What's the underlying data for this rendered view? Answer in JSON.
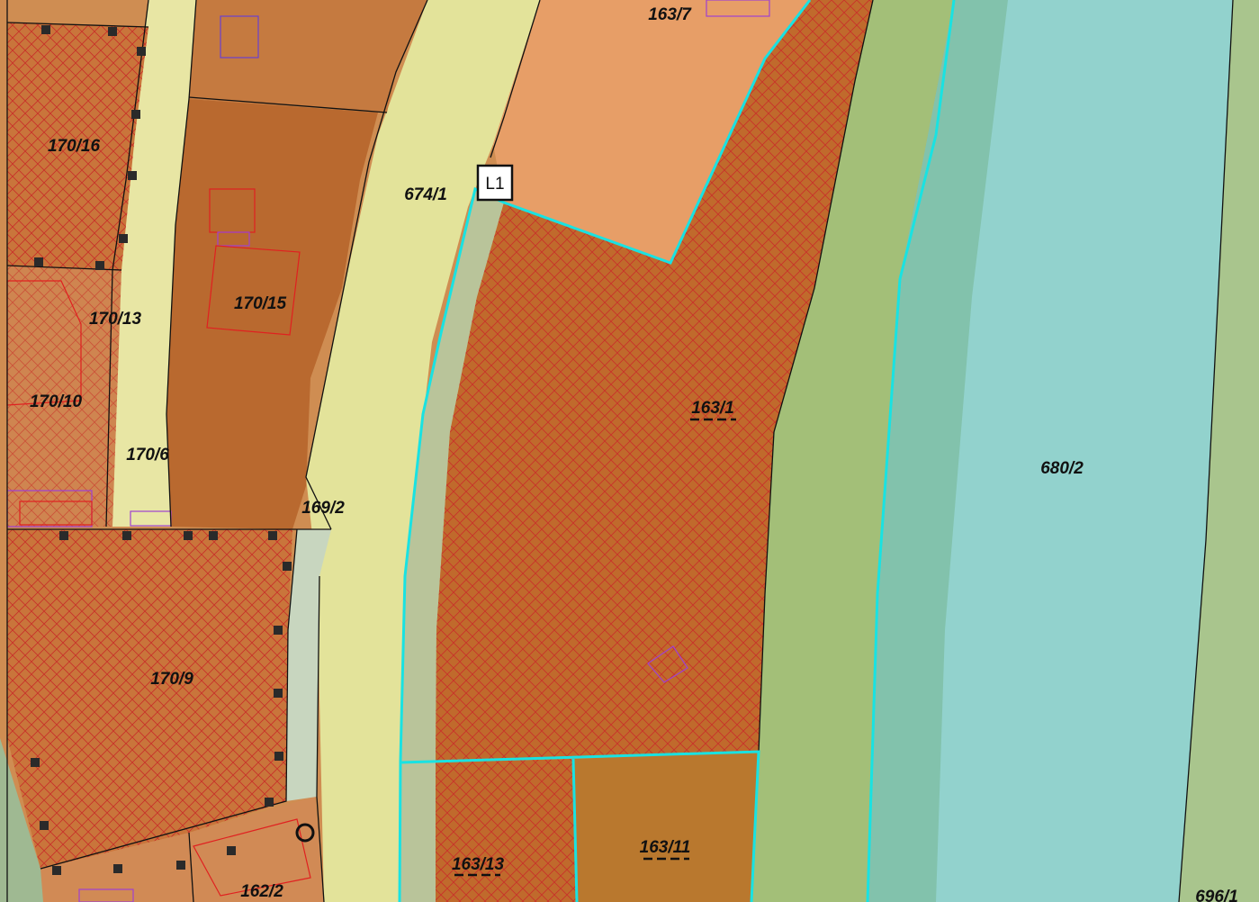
{
  "map": {
    "colors": {
      "parcel_fill": "#c9753b",
      "hatch": "#c8322a",
      "road": "#e6e49a",
      "sidewalk": "#f0efb0",
      "river": "#8fd3cf",
      "riverbank": "#9cbf7a",
      "highlight": "#19e2e2",
      "boundary": "#111111",
      "building_outline": "#e02020",
      "building_outline_alt": "#a040d0"
    },
    "parcels": {
      "p170_16": "170/16",
      "p170_15": "170/15",
      "p170_13": "170/13",
      "p170_10": "170/10",
      "p170_6": "170/6",
      "p170_9": "170/9",
      "p169_2": "169/2",
      "p674_1": "674/1",
      "p163_7": "163/7",
      "p163_1": "163/1",
      "p163_13": "163/13",
      "p163_11": "163/11",
      "p162_2": "162/2",
      "p680_2": "680/2",
      "p696_1": "696/1"
    },
    "marker": {
      "label": "L1"
    }
  }
}
